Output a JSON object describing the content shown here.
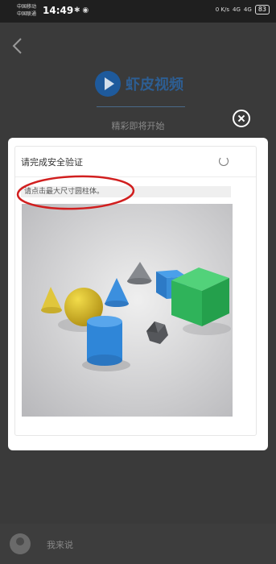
{
  "status_bar": {
    "carrier_1": "中国移动",
    "carrier_2": "中国联通",
    "time": "14:49",
    "battery": "83",
    "net_speed": "0 K/s",
    "signal_1": "4G",
    "signal_2": "4G"
  },
  "app": {
    "name": "虾皮视频",
    "tagline": "精彩即将开始",
    "comment_placeholder": "我来说"
  },
  "captcha": {
    "title": "请完成安全验证",
    "instruction": "请点击最大尺寸圆柱体。"
  },
  "colors": {
    "accent": "#2d5e93",
    "annotation": "#d11f1f"
  },
  "icons": [
    "back-chevron-icon",
    "play-logo-icon",
    "close-icon",
    "refresh-icon",
    "avatar-icon"
  ]
}
